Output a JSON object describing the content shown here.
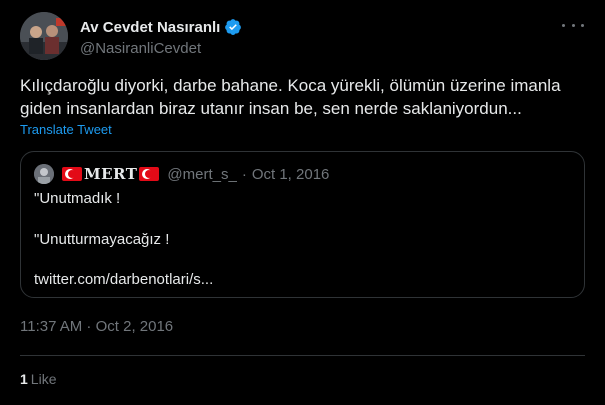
{
  "author": {
    "display_name": "Av Cevdet Nasıranlı",
    "handle": "@NasiranliCevdet",
    "verified": true,
    "avatar_icon": "avatar-photo"
  },
  "tweet": {
    "text": "Kılıçdaroğlu diyorki, darbe bahane. Koca yürekli, ölümün üzerine imanla giden insanlardan biraz utanır insan be, sen nerde saklaniyordun...",
    "translate_label": "Translate Tweet",
    "timestamp": "11:37 AM · Oct 2, 2016",
    "like_count": "1",
    "like_label": "Like"
  },
  "quote": {
    "display_name": "MERT",
    "handle": "@mert_s_",
    "separator": "·",
    "date": "Oct 1, 2016",
    "line1": "\"Unutmadık !",
    "line2": "\"Unutturmayacağız !",
    "link": "twitter.com/darbenotlari/s..."
  },
  "colors": {
    "background": "#000000",
    "text": "#e7e9ea",
    "muted": "#71767b",
    "accent": "#1d9bf0",
    "border": "#2f3336"
  }
}
